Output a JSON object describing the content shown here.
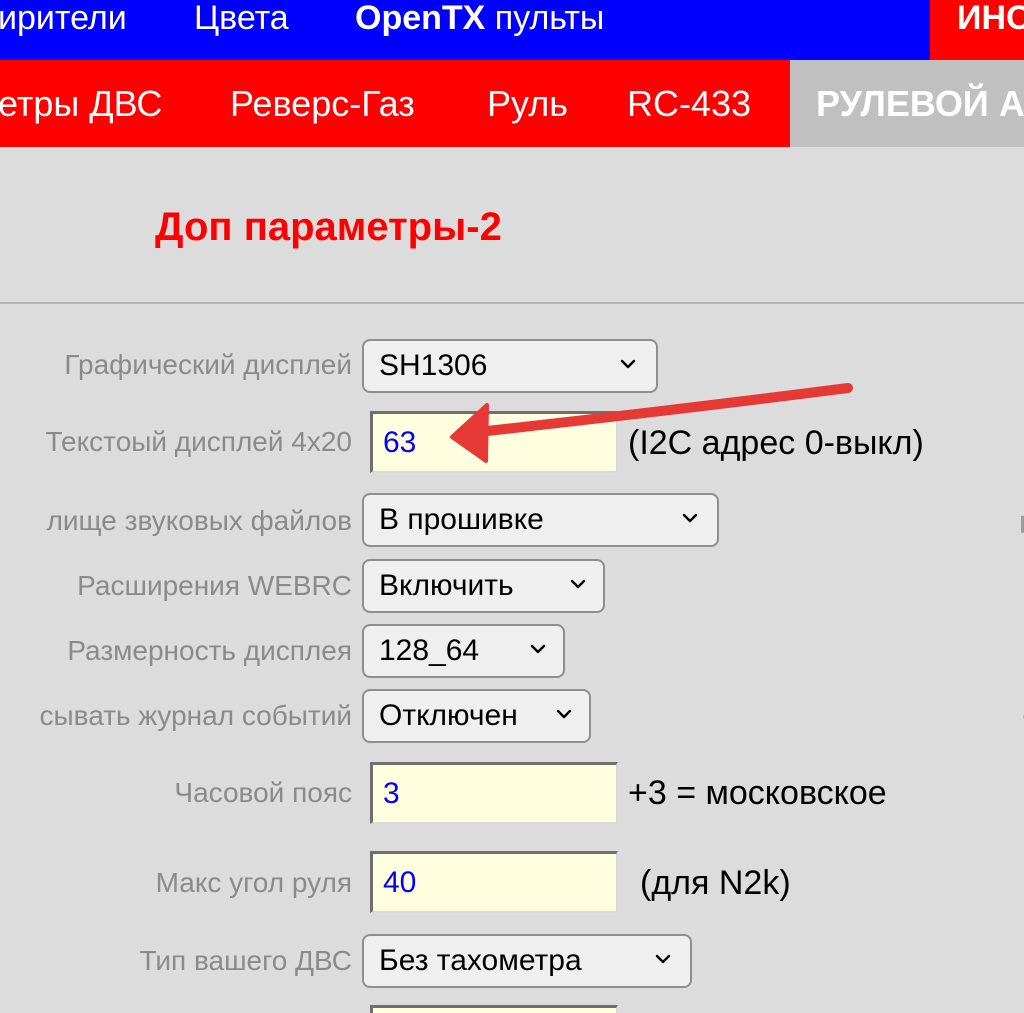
{
  "top_nav": {
    "items": [
      "ирители",
      "Цвета",
      "OpenTX",
      "пульты"
    ],
    "right_tab": "ИНС"
  },
  "sub_nav": {
    "items": [
      "етры ДВС",
      "Реверс-Газ",
      "Руль",
      "RC-433"
    ],
    "active_tab": "РУЛЕВОЙ А"
  },
  "heading": "Доп параметры-2",
  "settings": {
    "graphic_display": {
      "label": "Графический дисплей",
      "value": "SH1306"
    },
    "text_display": {
      "label": "Текстоый дисплей 4x20",
      "value": "63",
      "hint": "(I2C адрес 0-выкл)"
    },
    "sound_storage": {
      "label": "лище звуковых файлов",
      "value": "В прошивке"
    },
    "webrc_ext": {
      "label": "Расширения WEBRC",
      "value": "Включить"
    },
    "display_size": {
      "label": "Размерность дисплея",
      "value": "128_64"
    },
    "event_log": {
      "label": "сывать журнал событий",
      "value": "Отключен"
    },
    "timezone": {
      "label": "Часовой пояс",
      "value": "3",
      "hint": "+3 = московское"
    },
    "max_rudder": {
      "label": "Макс угол руля",
      "value": "40",
      "hint": "(для N2k)"
    },
    "engine_type": {
      "label": "Тип вашего ДВС",
      "value": "Без тахометра"
    }
  },
  "colors": {
    "top_nav_bg": "#0000ff",
    "sub_nav_bg": "#ff0000",
    "active_tab_bg": "#c0c0c0",
    "heading": "#ff0000",
    "input_bg": "#ffffe0",
    "input_text": "#0000ff",
    "annotation_arrow": "#e53935"
  },
  "icons": {
    "dropdown": "chevron-down-icon",
    "annotation": "red-arrow-annotation"
  }
}
